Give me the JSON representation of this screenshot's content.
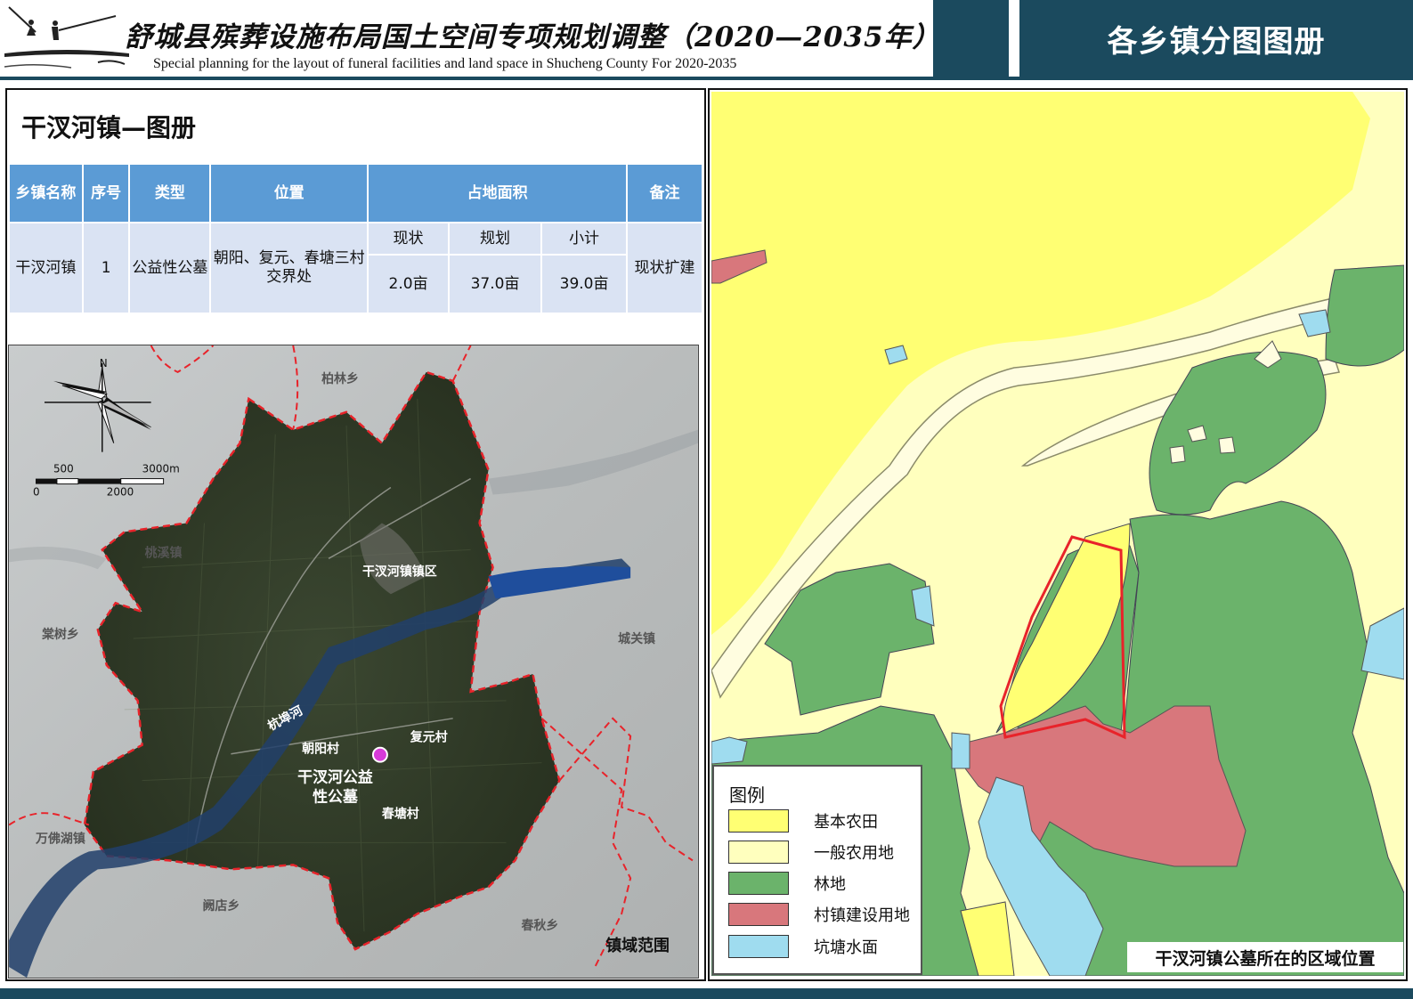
{
  "header": {
    "title_cn": "舒城县殡葬设施布局国土空间专项规划调整（2020—2035年）",
    "title_en": "Special planning for the layout of funeral facilities and land space in Shucheng County For 2020-2035",
    "atlas_title": "各乡镇分图图册",
    "colors": {
      "primary": "#1b4a5e",
      "table_header": "#5b9bd5",
      "table_cell": "#dae3f3"
    }
  },
  "section": {
    "title": "干汊河镇—图册"
  },
  "table": {
    "headers": {
      "township": "乡镇名称",
      "seq": "序号",
      "type": "类型",
      "location": "位置",
      "area": "占地面积",
      "notes": "备注"
    },
    "area_subheaders": [
      "现状",
      "规划",
      "小计"
    ],
    "row": {
      "township": "干汊河镇",
      "seq": "1",
      "type": "公益性公墓",
      "location": "朝阳、复元、春塘三村交界处",
      "area_current": "2.0亩",
      "area_planned": "37.0亩",
      "area_subtotal": "39.0亩",
      "notes": "现状扩建"
    }
  },
  "left_map": {
    "north_label": "N",
    "scale": {
      "top_left": "500",
      "top_right": "3000m",
      "bottom_left": "0",
      "bottom_mid": "2000"
    },
    "places": {
      "bailin": "柏林乡",
      "taoxi": "桃溪镇",
      "tangshu": "棠树乡",
      "chengguan": "城关镇",
      "wanfohu": "万佛湖镇",
      "kandian": "阙店乡",
      "chunqiu": "春秋乡",
      "town_center": "干汊河镇镇区",
      "river": "杭埠河",
      "chaoyang": "朝阳村",
      "fuyuan": "复元村",
      "chuntang": "春塘村"
    },
    "cemetery_label": [
      "干汊河公益",
      "性公墓"
    ],
    "caption": "镇域范围",
    "colors": {
      "boundary": "#e8232a",
      "river": "#1f4e9c",
      "marker": "#d63ad8"
    }
  },
  "right_map": {
    "legend_title": "图例",
    "legend": [
      {
        "label": "基本农田",
        "color": "#ffff73"
      },
      {
        "label": "一般农用地",
        "color": "#ffffbe"
      },
      {
        "label": "林地",
        "color": "#6bb36b"
      },
      {
        "label": "村镇建设用地",
        "color": "#d8777c"
      },
      {
        "label": "坑塘水面",
        "color": "#9fdcef"
      }
    ],
    "caption": "干汊河镇公墓所在的区域位置"
  }
}
